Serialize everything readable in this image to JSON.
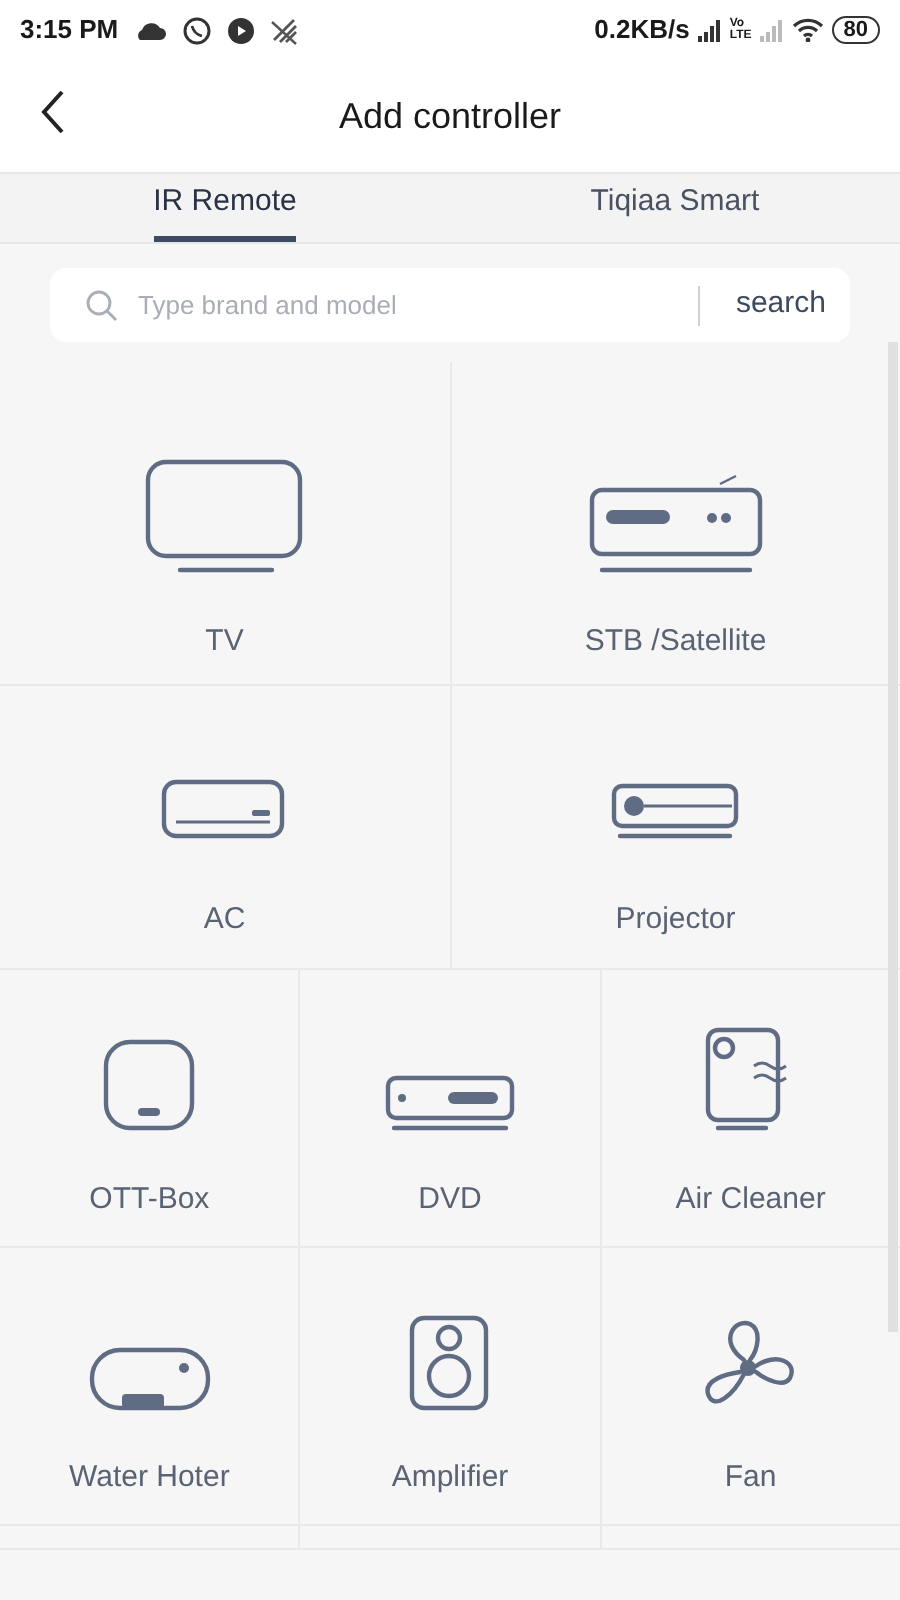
{
  "status_bar": {
    "time": "3:15 PM",
    "speed": "0.2KB/s",
    "volte_top": "Vo",
    "volte_bottom": "LTE",
    "battery": "80"
  },
  "header": {
    "title": "Add controller"
  },
  "tabs": [
    {
      "label": "IR Remote",
      "selected": true
    },
    {
      "label": "Tiqiaa Smart",
      "selected": false
    }
  ],
  "search": {
    "placeholder": "Type brand and model",
    "button": "search"
  },
  "device_rows": [
    [
      {
        "label": "TV",
        "kind": "tv"
      },
      {
        "label": "STB /Satellite",
        "kind": "stb"
      }
    ],
    [
      {
        "label": "AC",
        "kind": "ac"
      },
      {
        "label": "Projector",
        "kind": "projector"
      }
    ],
    [
      {
        "label": "OTT-Box",
        "kind": "ott"
      },
      {
        "label": "DVD",
        "kind": "dvd"
      },
      {
        "label": "Air Cleaner",
        "kind": "aircleaner"
      }
    ],
    [
      {
        "label": "Water Hoter",
        "kind": "waterheater"
      },
      {
        "label": "Amplifier",
        "kind": "amplifier"
      },
      {
        "label": "Fan",
        "kind": "fan"
      }
    ]
  ]
}
